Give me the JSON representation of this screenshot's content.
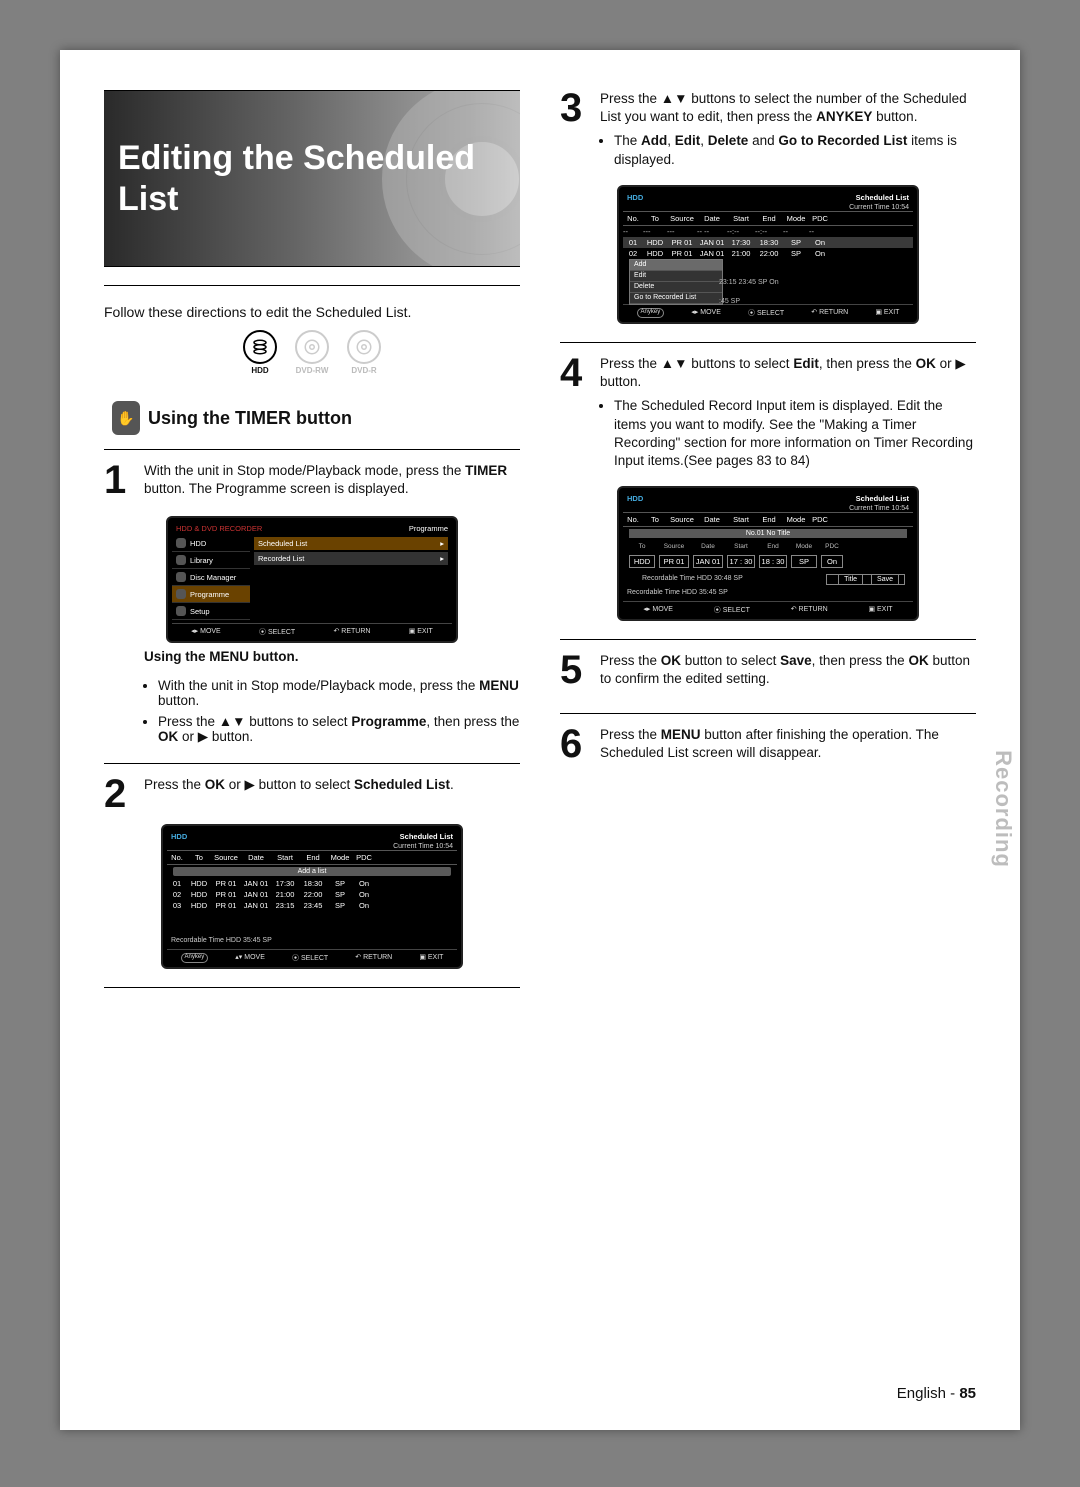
{
  "title": "Editing the Scheduled List",
  "intro": "Follow these directions to edit the Scheduled List.",
  "badges": [
    "HDD",
    "DVD-RW",
    "DVD-R"
  ],
  "section_heading": "Using the TIMER button",
  "hand_icon": "✋",
  "steps": {
    "s1": {
      "num": "1",
      "text": "With the unit in Stop mode/Playback mode, press the TIMER button. The Programme screen is displayed.",
      "sub_heading": "Using the MENU button.",
      "sub_items": [
        "With the unit in Stop mode/Playback mode, press the MENU button.",
        "Press the ▲▼ buttons to select Programme, then press the OK or ▶ button."
      ]
    },
    "s2": {
      "num": "2",
      "text": "Press the OK or ▶ button to select Scheduled List."
    },
    "s3": {
      "num": "3",
      "text": "Press the ▲▼ buttons to select the number of the Scheduled List you want to edit, then press the ANYKEY button.",
      "bullet": "The Add, Edit, Delete and Go to Recorded List items is displayed."
    },
    "s4": {
      "num": "4",
      "text": "Press the ▲▼ buttons to select Edit, then press the OK or ▶ button.",
      "bullet": "The Scheduled Record Input item is displayed. Edit the items you want to modify. See the \"Making a Timer Recording\" section for more information on Timer Recording Input items.(See pages 83 to 84)"
    },
    "s5": {
      "num": "5",
      "text": "Press the OK button to select Save, then press the OK button to confirm the edited setting."
    },
    "s6": {
      "num": "6",
      "text": "Press the MENU button after finishing the operation. The Scheduled List screen will disappear."
    }
  },
  "osd_common": {
    "hdd": "HDD",
    "title": "Scheduled List",
    "time_label": "Current Time 10:54",
    "cols": [
      "No.",
      "To",
      "Source",
      "Date",
      "Start",
      "End",
      "Mode",
      "PDC"
    ],
    "rows": [
      [
        "01",
        "HDD",
        "PR 01",
        "JAN 01",
        "17:30",
        "18:30",
        "SP",
        "On"
      ],
      [
        "02",
        "HDD",
        "PR 01",
        "JAN 01",
        "21:00",
        "22:00",
        "SP",
        "On"
      ],
      [
        "03",
        "HDD",
        "PR 01",
        "JAN 01",
        "23:15",
        "23:45",
        "SP",
        "On"
      ]
    ],
    "add_a_list": "Add a list",
    "rec_time": "Recordable Time    HDD  35:45 SP",
    "bottombar": {
      "anykey": "Anykey",
      "move": "MOVE",
      "select": "SELECT",
      "return": "RETURN",
      "exit": "EXIT"
    }
  },
  "osd_prog": {
    "brand": "HDD & DVD RECORDER",
    "label_programme": "Programme",
    "menu": [
      "HDD",
      "Library",
      "Disc Manager",
      "Programme",
      "Setup"
    ],
    "panel_items": [
      "Scheduled List",
      "Recorded List"
    ]
  },
  "osd_ctx": {
    "items": [
      "Add",
      "Edit",
      "Delete",
      "Go to Recorded List"
    ],
    "right_value": ":45 SP"
  },
  "osd_edit": {
    "bar": "No.01  No Title",
    "cols_edit": [
      "To",
      "Source",
      "Date",
      "Start",
      "End",
      "Mode",
      "PDC"
    ],
    "vals": [
      "HDD",
      "PR 01",
      "JAN 01",
      "17 : 30",
      "18 : 30",
      "SP",
      "On"
    ],
    "rec_time2": "Recordable Time   HDD   30:48 SP",
    "title_btn": "Title",
    "save_btn": "Save"
  },
  "side_tab": "Recording",
  "footer": {
    "lang": "English - ",
    "page": "85"
  }
}
